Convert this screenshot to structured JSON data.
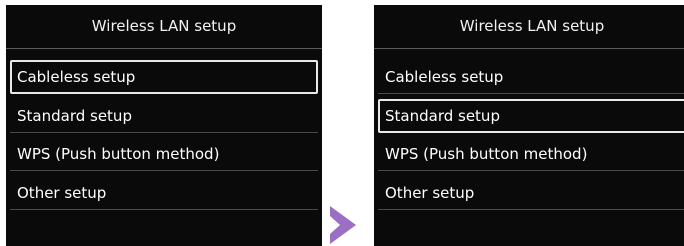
{
  "screens": [
    {
      "title": "Wireless LAN setup",
      "items": [
        {
          "label": "Cableless setup",
          "selected": true
        },
        {
          "label": "Standard setup",
          "selected": false
        },
        {
          "label": "WPS (Push button method)",
          "selected": false
        },
        {
          "label": "Other setup",
          "selected": false
        }
      ]
    },
    {
      "title": "Wireless LAN setup",
      "items": [
        {
          "label": "Cableless setup",
          "selected": false
        },
        {
          "label": "Standard setup",
          "selected": true
        },
        {
          "label": "WPS (Push button method)",
          "selected": false
        },
        {
          "label": "Other setup",
          "selected": false
        }
      ]
    }
  ],
  "arrow": {
    "icon": "chevron-right-icon",
    "color": "#9b6fc4"
  },
  "colors": {
    "screen_bg": "#0a0a0a",
    "text": "#ffffff",
    "selection_border": "#e8e8e8"
  }
}
